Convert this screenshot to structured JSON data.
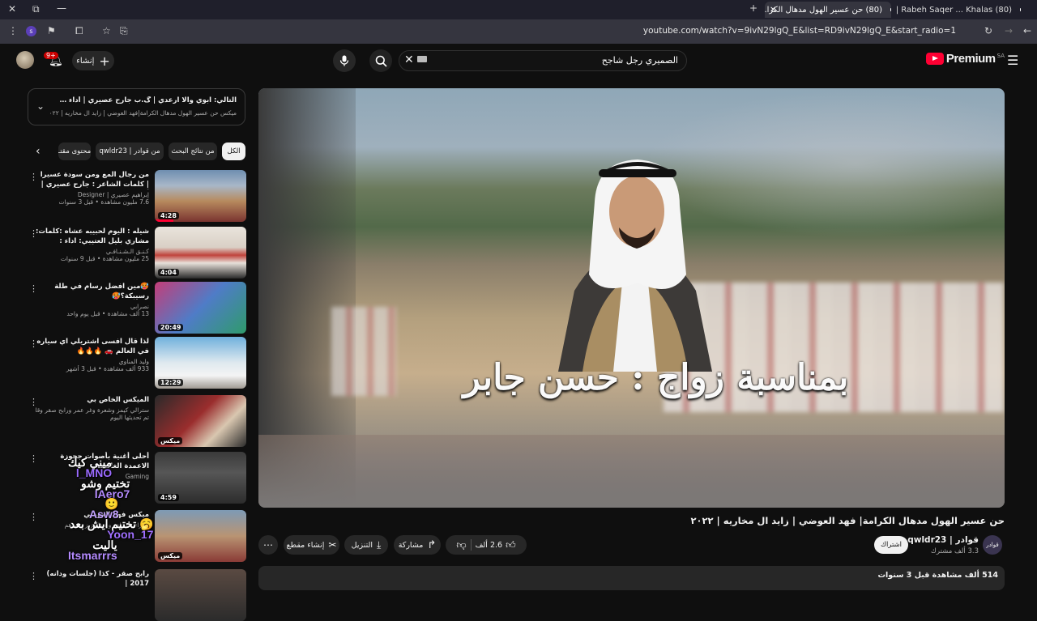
{
  "browser": {
    "tabs": [
      {
        "title": "(80) حن عسير الهول مدهال الكرا...",
        "active": true
      },
      {
        "title": "(80) Rabeh Saqer ... Khalas | ص",
        "active": false
      }
    ],
    "url": "youtube.com/watch?v=9ivN29lgQ_E&list=RD9ivN29lgQ_E&start_radio=1",
    "profile_letter": "s"
  },
  "header": {
    "logo_text": "Premium",
    "logo_region": "SA",
    "search_query": "الصميري رجل شاجح",
    "create_label": "إنشاء",
    "notifications": "9+"
  },
  "player": {
    "caption": "بمناسبة زواج : حسن جابر"
  },
  "video": {
    "title": "حن عسير الهول مدهال الكرامة| فهد العوضي | زايد ال مخاريه | ٢٠٢٢",
    "channel_name": "قوادر | qwldr23",
    "channel_avatar_text": "قوادر",
    "subscribers": "3.3 ألف مشترك",
    "subscribe_label": "اشتراك",
    "likes": "2.6 ألف",
    "share_label": "مشاركة",
    "download_label": "التنزيل",
    "clip_label": "إنشاء مقطع",
    "views_date": "514 ألف مشاهدة قبل 3 سنوات"
  },
  "playlist": {
    "next": "التالي: ابوي والا ارعدي | گ.ب جارح عصيري | أداء فهد العيسى | ح...",
    "sub": "ميكس حن عسير الهول مدهال الكرامة|فهد العوضي | زايد ال مخاريه | ٢٠٢٢"
  },
  "chips": [
    {
      "label": "الكل",
      "active": true
    },
    {
      "label": "من نتائج البحث",
      "active": false
    },
    {
      "label": "من قوادر | qwldr23",
      "active": false
    },
    {
      "label": "محتوى مقتـ",
      "active": false
    }
  ],
  "recommendations": [
    {
      "title": "من رجال المع ومن سودة عسيرا | كلمات الشاعر : جارح عصيري | أداء المنشدين يحيى...",
      "channel": "إبراهيم عصيري | Designer",
      "stats": "7.6 مليون مشاهدة • قبل 3 سنوات",
      "duration": "4:28",
      "progress": 0.2
    },
    {
      "title": "شيله : اليوم لحبيبه عشاه :كلمات: مشاري بليل العتيبي: اداء : عبدالعزيز اليامي",
      "channel": "كـنـق الـشـنـافـي",
      "stats": "25 مليون مشاهدة • قبل 9 سنوات",
      "duration": "4:04",
      "progress": 0
    },
    {
      "title": "🥵مين افضل رسام في طلة رسيبكة؟🥵",
      "channel": "نصرابي",
      "stats": "13 ألف مشاهدة • قبل يوم واحد",
      "duration": "20:49",
      "progress": 0
    },
    {
      "title": "لذا قال افسى اشتريلي اي سياره في العالم 🚗 🔥🔥🔥",
      "channel": "وليد المناوي",
      "stats": "933 ألف مشاهدة • قبل 3 أشهر",
      "duration": "12:29",
      "progress": 0
    },
    {
      "title": "الميكس الخاص بي",
      "channel": "سترالي كيمز وشعرة وغر عمر ورابح صقر وقاشون لعروس",
      "stats": "تم تحديثها اليوم",
      "duration": "ميكس",
      "progress": 0
    },
    {
      "title": "أحلى أغنية بأصوات جحوزة الاعمدة الغامضة",
      "channel": "Gaming",
      "stats": "",
      "duration": "4:59",
      "progress": 0
    },
    {
      "title": "ميكس فهد العوضي",
      "channel": "سترالي وخلف وعبدالعزيز وغيرهم",
      "stats": "",
      "duration": "ميكس",
      "progress": 0
    },
    {
      "title": "رابح صقر - كذا (جلسات ودانه) 2017 |",
      "channel": "",
      "stats": "",
      "duration": "",
      "progress": 0
    }
  ],
  "chat_overlay": [
    {
      "user": "l_MNO",
      "message": "ميني كيك",
      "color": "#9b6bff"
    },
    {
      "user": "IAero7",
      "message": "تختيم وشو",
      "color": "#b58bff"
    },
    {
      "user": "Asw8",
      "message": "🙂",
      "color": "#c3a2ff"
    },
    {
      "user": "Yoon_17",
      "message": "🥱 تختيم ايش بعد",
      "color": "#a070ff"
    },
    {
      "user": "Itsmarrrs",
      "message": "ياليت",
      "color": "#b58bff"
    }
  ],
  "colors": {
    "accent": "#ff0033",
    "background": "#0f0f0f",
    "chrome": "#35353f"
  }
}
